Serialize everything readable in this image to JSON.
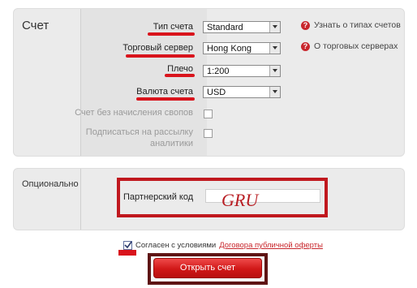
{
  "main_panel": {
    "title": "Счет",
    "account_type": {
      "label": "Тип счета",
      "value": "Standard"
    },
    "trade_server": {
      "label": "Торговый сервер",
      "value": "Hong Kong"
    },
    "leverage": {
      "label": "Плечо",
      "value": "1:200"
    },
    "currency": {
      "label": "Валюта счета",
      "value": "USD"
    },
    "swap_free": {
      "label": "Счет без начисления свопов",
      "checked": false
    },
    "subscribe": {
      "label_line1": "Подписаться на рассылку",
      "label_line2": "аналитики",
      "checked": false
    },
    "help_links": [
      "Узнать о типах счетов",
      "О торговых серверах"
    ]
  },
  "optional_panel": {
    "title": "Опционально",
    "partner_code": {
      "label": "Партнерский код",
      "value": "GRU"
    }
  },
  "agreement": {
    "checked": true,
    "text": "Согласен с условиями",
    "link": "Договора публичной оферты"
  },
  "submit_button": {
    "label": "Открыть счет"
  },
  "colors": {
    "accent": "#c8262c",
    "highlight": "#d9141c"
  }
}
